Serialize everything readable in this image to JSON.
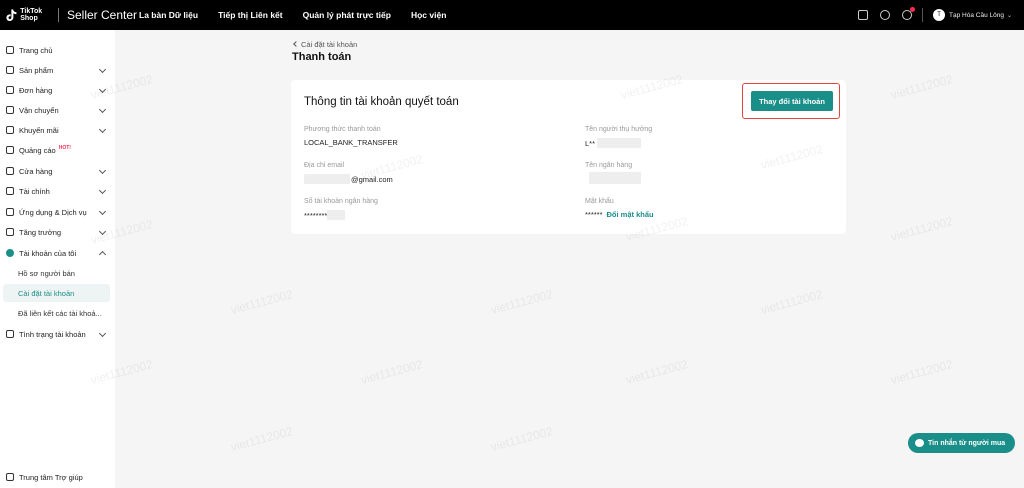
{
  "topbar": {
    "logo_text": "TikTok Shop",
    "brand": "Seller Center",
    "nav": [
      "La bàn Dữ liệu",
      "Tiếp thị Liên kết",
      "Quản lý phát trực tiếp",
      "Học viện"
    ],
    "user_initials": "T",
    "user_name": "Tạp Hóa Cầu Lông"
  },
  "sidebar": {
    "items": [
      {
        "label": "Trang chủ",
        "icon": "home-icon"
      },
      {
        "label": "Sản phẩm",
        "icon": "product-icon"
      },
      {
        "label": "Đơn hàng",
        "icon": "order-icon"
      },
      {
        "label": "Vận chuyển",
        "icon": "truck-icon"
      },
      {
        "label": "Khuyến mãi",
        "icon": "megaphone-icon"
      },
      {
        "label": "Quảng cáo",
        "icon": "ads-icon",
        "badge": "HOT!"
      },
      {
        "label": "Cửa hàng",
        "icon": "store-icon"
      },
      {
        "label": "Tài chính",
        "icon": "finance-icon"
      },
      {
        "label": "Ứng dụng & Dịch vụ",
        "icon": "apps-icon"
      },
      {
        "label": "Tăng trưởng",
        "icon": "growth-icon"
      },
      {
        "label": "Tài khoản của tôi",
        "icon": "user-icon"
      }
    ],
    "subitems": [
      "Hồ sơ người bán",
      "Cài đặt tài khoản",
      "Đã liên kết các tài khoả..."
    ],
    "status_item": "Tình trạng tài khoản",
    "help": "Trung tâm Trợ giúp"
  },
  "breadcrumb": "Cài đặt tài khoản",
  "page_title": "Thanh toán",
  "card": {
    "title": "Thông tin tài khoản quyết toán",
    "change_button": "Thay đổi tài khoản",
    "fields": {
      "method_label": "Phương thức thanh toán",
      "method_value": "LOCAL_BANK_TRANSFER",
      "beneficiary_label": "Tên người thụ hưởng",
      "beneficiary_value": "L**",
      "email_label": "Địa chỉ email",
      "email_value": "@gmail.com",
      "bank_label": "Tên ngân hàng",
      "account_label": "Số tài khoản ngân hàng",
      "account_value": "********",
      "password_label": "Mật khẩu",
      "password_value": "******",
      "change_password": "Đổi mật khẩu"
    }
  },
  "chat_button": "Tin nhắn từ người mua",
  "watermark": "viet1112002",
  "colors": {
    "accent": "#1a8e89",
    "highlight": "#e2453c",
    "hot": "#fe2c55"
  }
}
